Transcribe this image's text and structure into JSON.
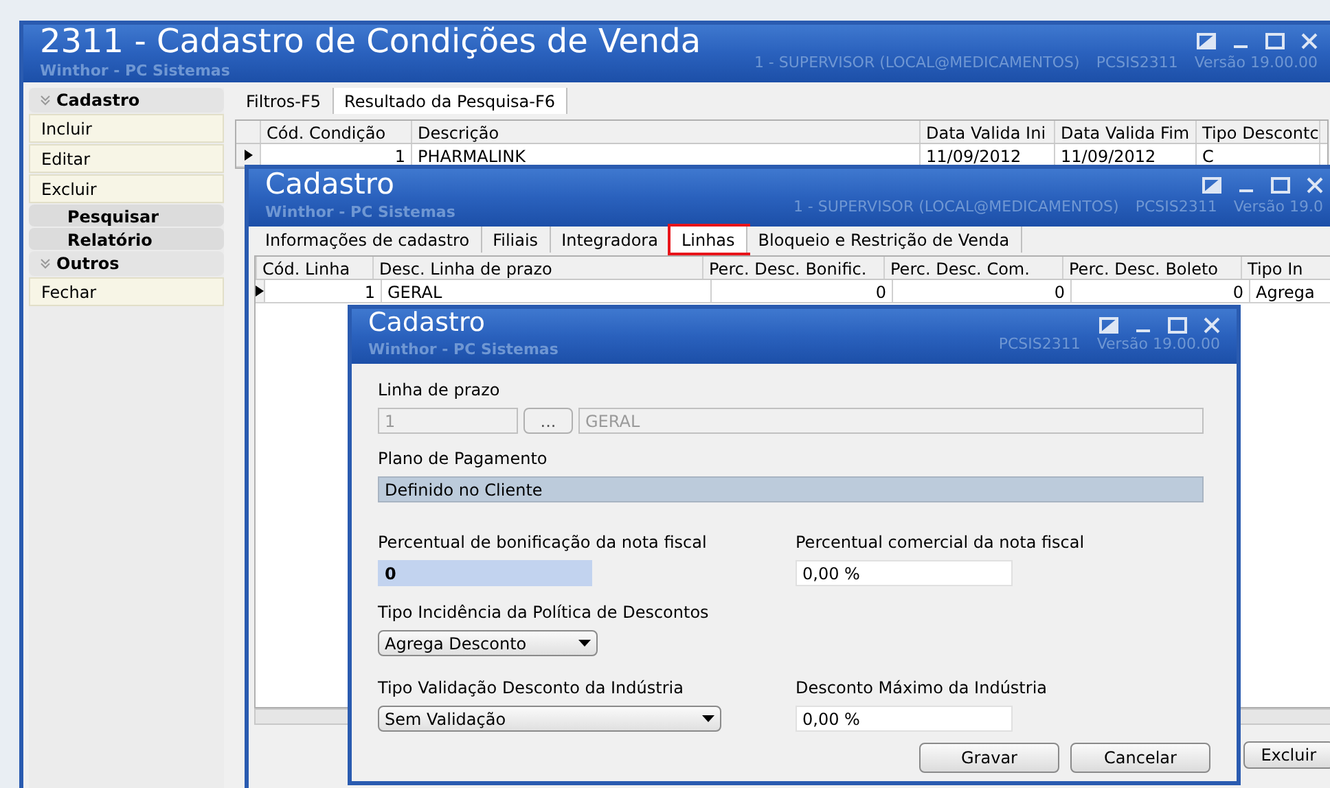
{
  "main_window": {
    "title": "2311 - Cadastro de Condições de Venda",
    "subtitle": "Winthor - PC Sistemas",
    "status": [
      "1 - SUPERVISOR (LOCAL@MEDICAMENTOS)",
      "PCSIS2311",
      "Versão 19.00.00"
    ],
    "sidebar": [
      {
        "kind": "group",
        "label": "Cadastro"
      },
      {
        "kind": "item",
        "label": "Incluir"
      },
      {
        "kind": "item",
        "label": "Editar"
      },
      {
        "kind": "item",
        "label": "Excluir"
      },
      {
        "kind": "header",
        "label": "Pesquisar"
      },
      {
        "kind": "header",
        "label": "Relatório"
      },
      {
        "kind": "group",
        "label": "Outros"
      },
      {
        "kind": "item",
        "label": "Fechar"
      }
    ],
    "tabs": [
      {
        "label": "Filtros-F5",
        "selected": false
      },
      {
        "label": "Resultado da Pesquisa-F6",
        "selected": true
      }
    ],
    "table": {
      "columns": [
        "Cód. Condição",
        "Descrição",
        "Data Valida Ini",
        "Data Valida Fim",
        "Tipo Descontc"
      ],
      "rows": [
        [
          "1",
          "PHARMALINK",
          "11/09/2012",
          "11/09/2012",
          "C"
        ]
      ]
    }
  },
  "cadastro_window": {
    "title": "Cadastro",
    "subtitle": "Winthor - PC Sistemas",
    "status": [
      "1 - SUPERVISOR (LOCAL@MEDICAMENTOS)",
      "PCSIS2311",
      "Versão 19.0"
    ],
    "tabs": [
      {
        "label": "Informações de cadastro",
        "selected": false,
        "highlighted": false
      },
      {
        "label": "Filiais",
        "selected": false,
        "highlighted": false
      },
      {
        "label": "Integradora",
        "selected": false,
        "highlighted": false
      },
      {
        "label": "Linhas",
        "selected": true,
        "highlighted": true
      },
      {
        "label": "Bloqueio e Restrição de Venda",
        "selected": false,
        "highlighted": false
      }
    ],
    "table": {
      "columns": [
        "Cód. Linha",
        "Desc. Linha de prazo",
        "Perc. Desc. Bonific.",
        "Perc. Desc. Com.",
        "Perc. Desc. Boleto",
        "Tipo In"
      ],
      "rows": [
        [
          "1",
          "GERAL",
          "0",
          "0",
          "0",
          "Agrega"
        ]
      ]
    },
    "buttons": [
      "Excluir"
    ]
  },
  "dialog": {
    "title": "Cadastro",
    "subtitle": "Winthor - PC Sistemas",
    "status": [
      "PCSIS2311",
      "Versão 19.00.00"
    ],
    "linha_de_prazo": {
      "label": "Linha de prazo",
      "code": "1",
      "lookup": "...",
      "name": "GERAL"
    },
    "plano_de_pagamento": {
      "label": "Plano de Pagamento",
      "value": "Definido no Cliente"
    },
    "percentual_bonificacao": {
      "label": "Percentual de bonificação da nota fiscal",
      "value": "0"
    },
    "percentual_comercial": {
      "label": "Percentual comercial da nota fiscal",
      "value": "0,00 %"
    },
    "tipo_incidencia": {
      "label": "Tipo Incidência da Política de Descontos",
      "value": "Agrega Desconto"
    },
    "tipo_validacao": {
      "label": "Tipo Validação Desconto da Indústria",
      "value": "Sem Validação"
    },
    "desconto_maximo": {
      "label": "Desconto Máximo da Indústria",
      "value": "0,00 %"
    },
    "buttons": [
      "Gravar",
      "Cancelar"
    ]
  }
}
